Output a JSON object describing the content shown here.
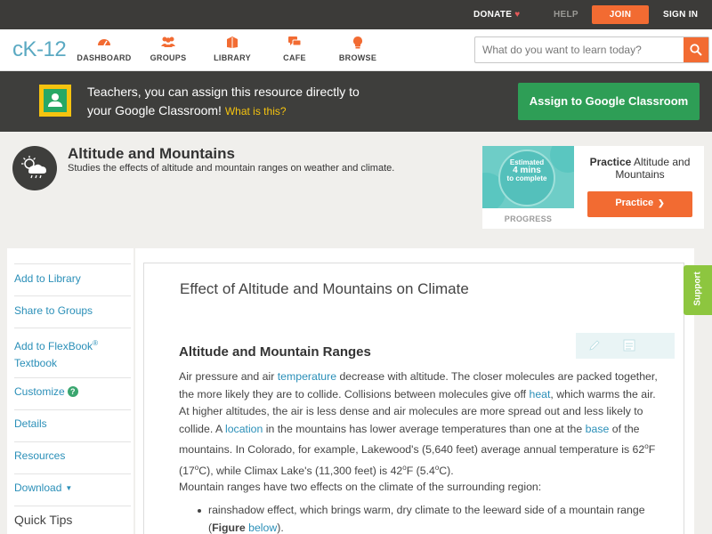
{
  "topbar": {
    "donate": "DONATE",
    "help": "HELP",
    "join": "JOIN",
    "signin": "SIGN IN"
  },
  "nav": {
    "logo": "cK-12",
    "items": [
      {
        "label": "DASHBOARD",
        "icon": "dashboard-icon"
      },
      {
        "label": "GROUPS",
        "icon": "groups-icon"
      },
      {
        "label": "LIBRARY",
        "icon": "library-icon"
      },
      {
        "label": "CAFE",
        "icon": "cafe-icon"
      },
      {
        "label": "BROWSE",
        "icon": "browse-icon"
      }
    ],
    "search_placeholder": "What do you want to learn today?"
  },
  "classroom_banner": {
    "line1": "Teachers, you can assign this resource directly to",
    "line2": "your Google Classroom!",
    "what_is_this": "What is this?",
    "button": "Assign to Google Classroom"
  },
  "concept": {
    "title": "Altitude and Mountains",
    "subtitle": "Studies the effects of altitude and mountain ranges on weather and climate."
  },
  "practice": {
    "estimated_line1": "Estimated",
    "estimated_line2": "4 mins",
    "estimated_line3": "to complete",
    "progress_label": "PROGRESS",
    "title_prefix": "Practice",
    "title_rest": "Altitude and Mountains",
    "button": "Practice"
  },
  "sidebar": {
    "add_to_library": "Add to Library",
    "share_to_groups": "Share to Groups",
    "add_to_flexbook": "Add to FlexBook",
    "registered": "®",
    "textbook": "Textbook",
    "customize": "Customize",
    "customize_help": "?",
    "details": "Details",
    "resources": "Resources",
    "download": "Download",
    "download_caret": "▼",
    "quick_tips": "Quick Tips"
  },
  "article": {
    "title": "Effect of Altitude and Mountains on Climate",
    "section_heading": "Altitude and Mountain Ranges",
    "p1": {
      "s1": "Air pressure and air ",
      "l1": "temperature",
      "s2": " decrease with altitude. The closer molecules are packed together, the more likely they are to collide. Collisions between molecules give off ",
      "l2": "heat",
      "s3": ", which warms the air. At higher altitudes, the air is less dense and air molecules are more spread out and less likely to collide. A ",
      "l3": "location",
      "s4": " in the mountains has lower average temperatures than one at the ",
      "l4": "base",
      "s5": " of the mountains. In Colorado, for example, Lakewood's (5,640 feet) average annual temperature is 62",
      "deg": "o",
      "s6": "F (17",
      "s7": "C), while Climax Lake's (11,300 feet) is 42",
      "s8": "F (5.4",
      "s9": "C)."
    },
    "p2": "Mountain ranges have two effects on the climate of the surrounding region:",
    "bullet1": {
      "text": "rainshadow effect, which brings warm, dry climate to the leeward side of a mountain range (",
      "bold": "Figure",
      "space": " ",
      "link": "below",
      "end": ")."
    }
  },
  "support_tab": "Support",
  "colors": {
    "accent_orange": "#f26b32",
    "link_blue": "#2a8fb8",
    "green": "#2e9e56",
    "banner_dark": "#3e3e3c",
    "support_green": "#8dc63f"
  }
}
